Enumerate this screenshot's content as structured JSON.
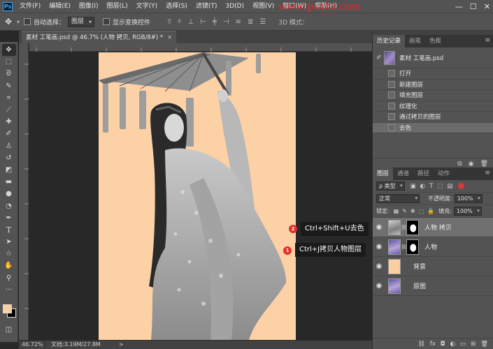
{
  "app": {
    "logo": "Ps"
  },
  "menu": [
    "文件(F)",
    "编辑(E)",
    "图像(I)",
    "图层(L)",
    "文字(Y)",
    "选择(S)",
    "滤镜(T)",
    "3D(D)",
    "视图(V)",
    "窗口(W)",
    "帮助(H)"
  ],
  "watermark": "www.psahz.com",
  "options": {
    "auto_select_label": "自动选择：",
    "auto_select_value": "图层",
    "show_transform_label": "显示变换控件",
    "mode_3d_label": "3D 模式："
  },
  "document": {
    "tab_title": "素材 工笔画.psd @ 46.7% (人物 拷贝, RGB/8#) *",
    "close_glyph": "×",
    "artboard_color": "#fdd1a6"
  },
  "callouts": [
    {
      "badge": "2",
      "text": "Ctrl+Shift+U去色"
    },
    {
      "badge": "1",
      "text": "Ctrl+J拷贝人物图层"
    }
  ],
  "statusbar": {
    "zoom": "46.72%",
    "doc": "文档:3.19M/27.8M",
    "arrow": ">"
  },
  "history": {
    "tabs": [
      "历史记录",
      "画笔",
      "色板"
    ],
    "snapshot": "素材 工笔画.psd",
    "steps": [
      "打开",
      "新建图层",
      "填充图层",
      "纹理化",
      "通过拷贝的图层",
      "去色"
    ],
    "active_step": 5
  },
  "layers": {
    "tabs": [
      "图层",
      "通道",
      "路径",
      "动作"
    ],
    "filter_label": "ρ 类型",
    "blend_mode": "正常",
    "opacity_label": "不透明度:",
    "opacity_value": "100%",
    "lock_label": "锁定:",
    "fill_label": "填充:",
    "fill_value": "100%",
    "items": [
      {
        "name": "人物 拷贝",
        "selected": true
      },
      {
        "name": "人物",
        "selected": false
      },
      {
        "name": "背景",
        "selected": false
      },
      {
        "name": "原图",
        "selected": false
      }
    ]
  },
  "icons": {
    "tools": [
      "move-tool-icon",
      "marquee-tool-icon",
      "lasso-tool-icon",
      "quick-select-tool-icon",
      "crop-tool-icon",
      "eyedropper-tool-icon",
      "healing-brush-tool-icon",
      "brush-tool-icon",
      "clone-stamp-tool-icon",
      "history-brush-tool-icon",
      "eraser-tool-icon",
      "gradient-tool-icon",
      "blur-tool-icon",
      "dodge-tool-icon",
      "pen-tool-icon",
      "type-tool-icon",
      "path-select-tool-icon",
      "shape-tool-icon",
      "hand-tool-icon",
      "zoom-tool-icon",
      "more-tools-icon"
    ]
  },
  "colors": {
    "foreground": "#f8cfa0",
    "background": "#000000",
    "accent_badge": "#e2302a",
    "watermark": "#e8262b"
  }
}
